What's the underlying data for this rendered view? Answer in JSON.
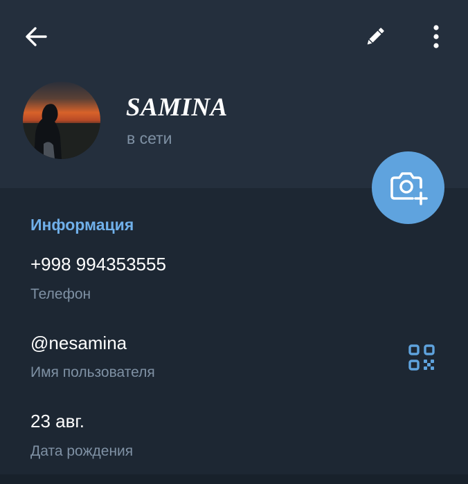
{
  "profile": {
    "name": "SAMINA",
    "status": "в сети"
  },
  "info": {
    "section_title": "Информация",
    "phone": {
      "value": "+998 994353555",
      "label": "Телефон"
    },
    "username": {
      "value": "@nesamina",
      "label": "Имя пользователя"
    },
    "birthday": {
      "value": "23 авг.",
      "label": "Дата рождения"
    }
  },
  "icons": {
    "back": "arrow-left-icon",
    "edit": "pencil-icon",
    "more": "more-vertical-icon",
    "camera": "camera-add-icon",
    "qr": "qr-code-icon"
  },
  "colors": {
    "header_bg": "#242f3d",
    "body_bg": "#1d2733",
    "accent": "#5fa3de",
    "section_title": "#70b0ea",
    "secondary_text": "#7f91a4"
  }
}
